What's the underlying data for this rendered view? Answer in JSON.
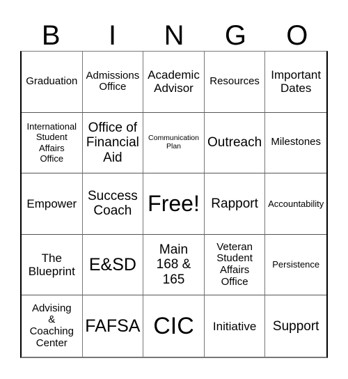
{
  "header": {
    "letters": [
      "B",
      "I",
      "N",
      "G",
      "O"
    ]
  },
  "grid": {
    "rows": [
      [
        "Graduation",
        "Admissions Office",
        "Academic Advisor",
        "Resources",
        "Important Dates"
      ],
      [
        "International Student Affairs Office",
        "Office of Financial Aid",
        "Communication Plan",
        "Outreach",
        "Milestones"
      ],
      [
        "Empower",
        "Success Coach",
        "Free!",
        "Rapport",
        "Accountability"
      ],
      [
        "The Blueprint",
        "E&SD",
        "Main 168 & 165",
        "Veteran Student Affairs Office",
        "Persistence"
      ],
      [
        "Advising & Coaching Center",
        "FAFSA",
        "CIC",
        "Initiative",
        "Support"
      ]
    ]
  },
  "display": {
    "r0": [
      "Graduation",
      "Admissions\nOffice",
      "Academic\nAdvisor",
      "Resources",
      "Important\nDates"
    ],
    "r1": [
      "International\nStudent\nAffairs\nOffice",
      "Office of\nFinancial\nAid",
      "Communication\nPlan",
      "Outreach",
      "Milestones"
    ],
    "r2": [
      "Empower",
      "Success\nCoach",
      "Free!",
      "Rapport",
      "Accountability"
    ],
    "r3": [
      "The\nBlueprint",
      "E&SD",
      "Main\n168 &\n165",
      "Veteran\nStudent\nAffairs\nOffice",
      "Persistence"
    ],
    "r4": [
      "Advising\n&\nCoaching\nCenter",
      "FAFSA",
      "CIC",
      "Initiative",
      "Support"
    ]
  },
  "colors": {
    "text": "#000000",
    "background": "#ffffff",
    "grid_line": "#777777"
  }
}
